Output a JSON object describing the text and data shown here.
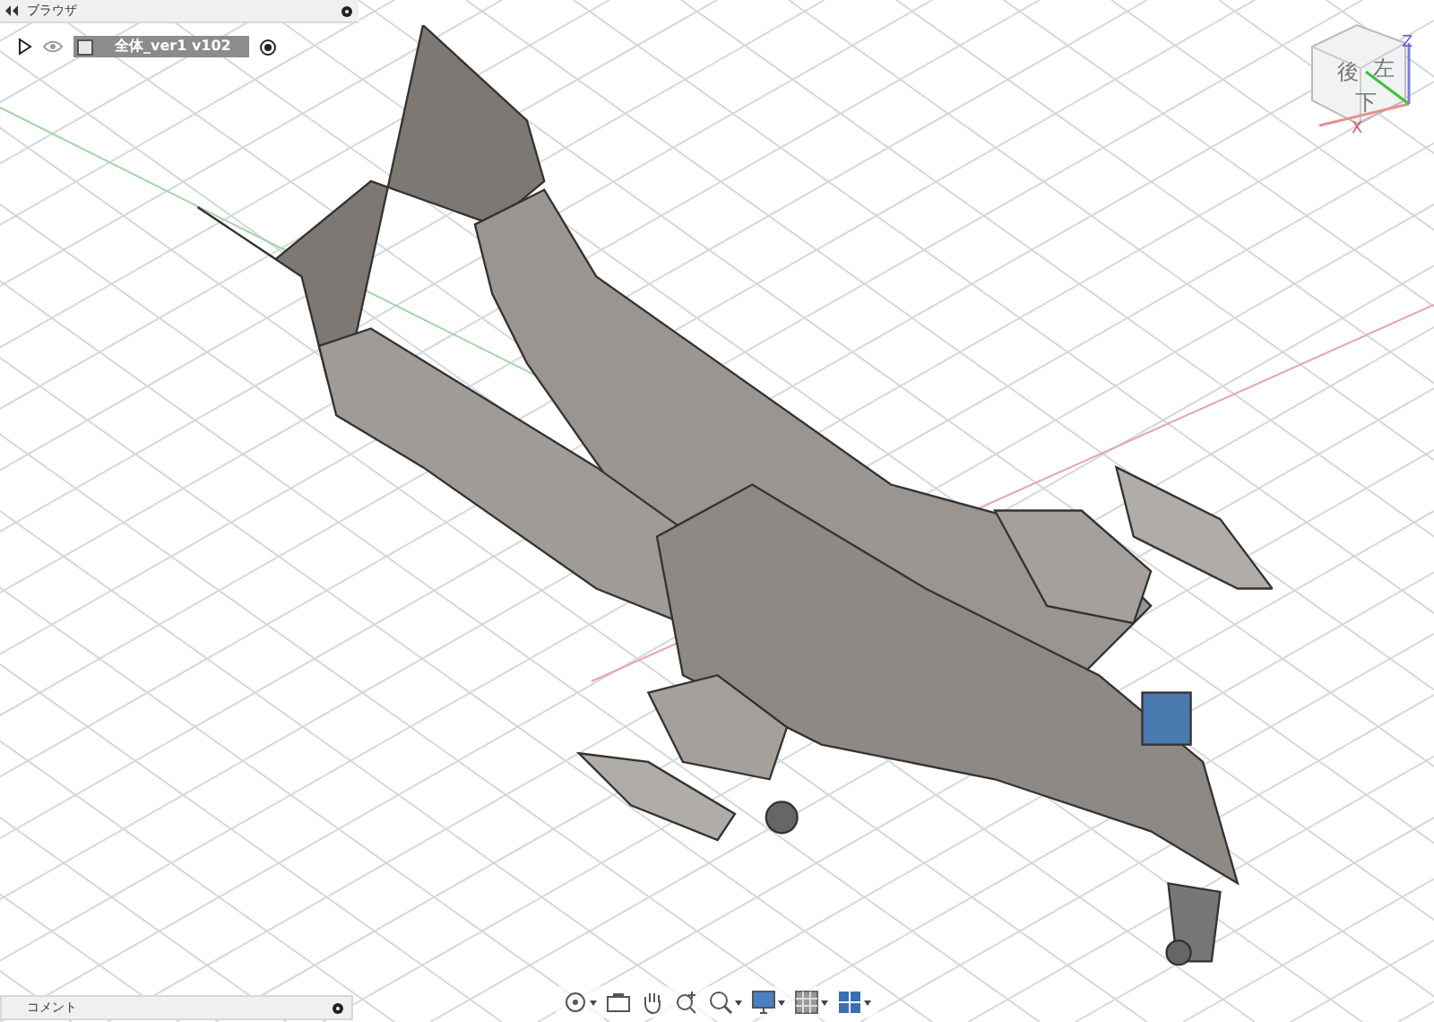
{
  "browser_panel": {
    "title": "ブラウザ",
    "root": {
      "name": "全体_ver1 v102",
      "expanded": false,
      "visible": true
    }
  },
  "view_cube": {
    "faces": [
      "後",
      "左",
      "下"
    ],
    "axes": [
      "Z",
      "X"
    ]
  },
  "toolbar": [
    {
      "kind": "orbit",
      "dropdown": true
    },
    {
      "kind": "look",
      "dropdown": false
    },
    {
      "kind": "pan",
      "dropdown": false
    },
    {
      "kind": "zoom",
      "dropdown": false
    },
    {
      "kind": "fit",
      "dropdown": true
    },
    {
      "kind": "display",
      "dropdown": true
    },
    {
      "kind": "grid",
      "dropdown": true
    },
    {
      "kind": "viewports",
      "dropdown": true
    }
  ],
  "comments_panel": {
    "title": "コメント"
  }
}
